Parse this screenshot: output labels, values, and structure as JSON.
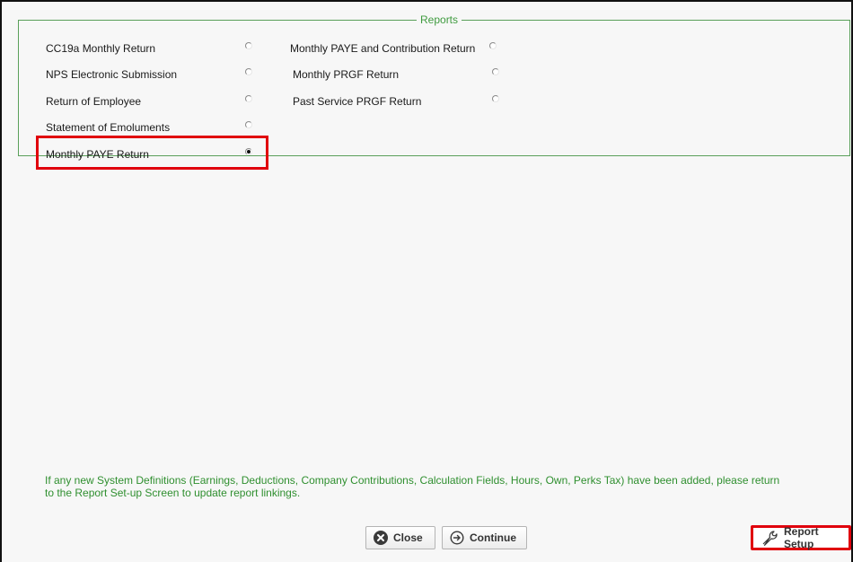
{
  "reports_group": {
    "title": "Reports",
    "left_options": [
      {
        "label": "CC19a Monthly Return",
        "checked": false
      },
      {
        "label": "NPS Electronic Submission",
        "checked": false
      },
      {
        "label": "Return of Employee",
        "checked": false
      },
      {
        "label": "Statement of Emoluments",
        "checked": false
      },
      {
        "label": "Monthly PAYE Return",
        "checked": true
      }
    ],
    "right_options": [
      {
        "label": "Monthly PAYE and Contribution Return",
        "checked": false
      },
      {
        "label": "Monthly PRGF Return",
        "checked": false
      },
      {
        "label": "Past Service PRGF Return",
        "checked": false
      }
    ]
  },
  "info": {
    "line1": "If any new System Definitions (Earnings, Deductions, Company Contributions, Calculation Fields, Hours, Own, Perks Tax) have been added, please return",
    "line2": "to the Report Set-up Screen to update report linkings."
  },
  "buttons": {
    "close": "Close",
    "continue": "Continue",
    "report_setup": "Report Setup"
  },
  "icons": {
    "close": "close-circle-icon",
    "continue": "arrow-right-circle-icon",
    "report_setup": "wrench-icon"
  },
  "colors": {
    "accent_green": "#3f9b3f",
    "highlight_red": "#e0000c"
  }
}
